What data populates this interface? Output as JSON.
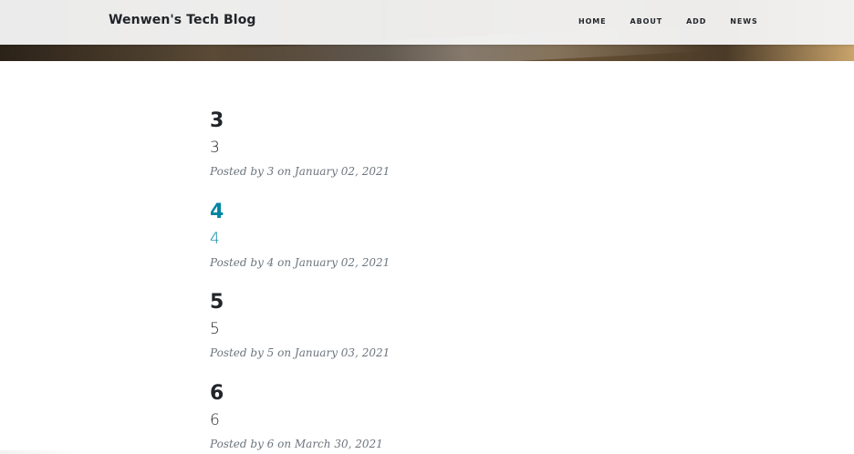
{
  "header": {
    "brand": "Wenwen's Tech Blog",
    "nav": [
      "HOME",
      "ABOUT",
      "ADD",
      "NEWS"
    ]
  },
  "posts": [
    {
      "title": "3",
      "subtitle": "3",
      "meta": "Posted by 3 on January 02, 2021"
    },
    {
      "title": "4",
      "subtitle": "4",
      "meta": "Posted by 4 on January 02, 2021"
    },
    {
      "title": "5",
      "subtitle": "5",
      "meta": "Posted by 5 on January 03, 2021"
    },
    {
      "title": "6",
      "subtitle": "6",
      "meta": "Posted by 6 on March 30, 2021"
    }
  ],
  "colors": {
    "text": "#212529",
    "link_hover": "#0085a1",
    "meta": "#6c757d",
    "navbar_bg": "#f4f4f4"
  }
}
